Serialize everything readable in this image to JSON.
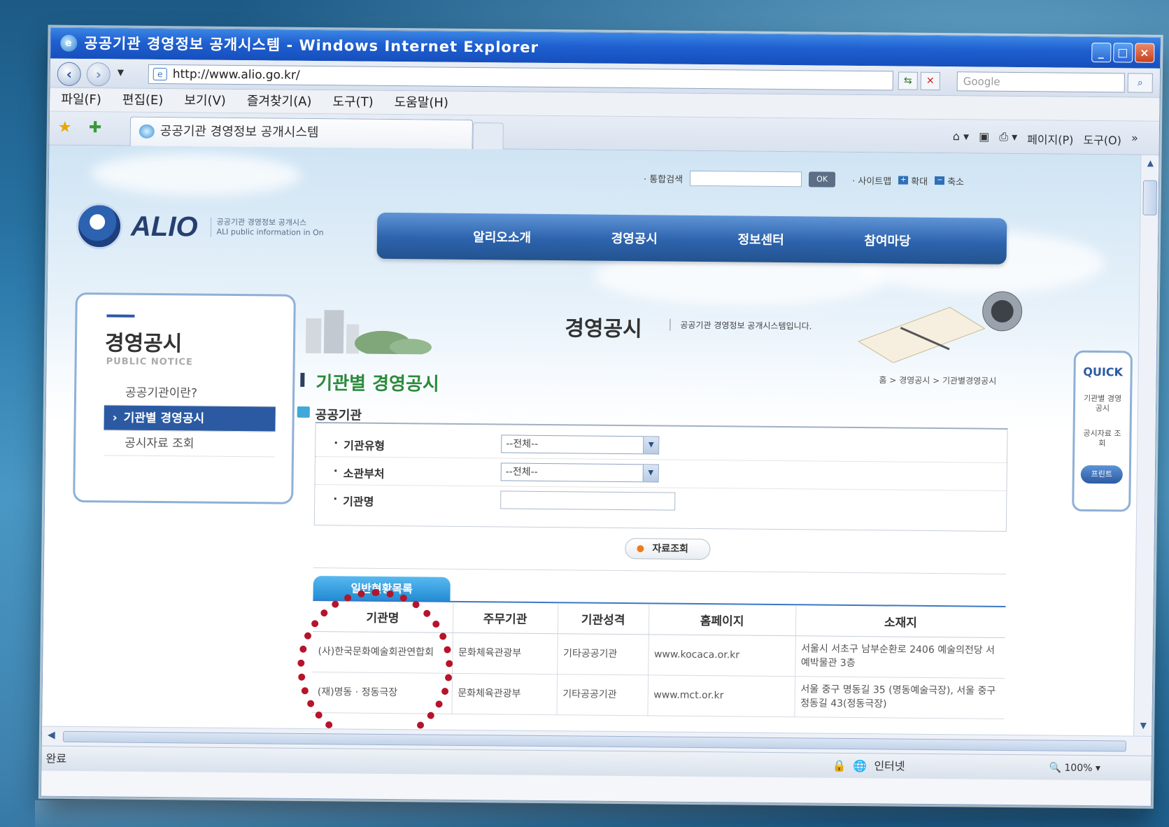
{
  "window": {
    "title": "공공기관 경영정보 공개시스템 - Windows Internet Explorer",
    "address": "http://www.alio.go.kr/",
    "search_placeholder": "Google"
  },
  "menubar": [
    "파일(F)",
    "편집(E)",
    "보기(V)",
    "즐겨찾기(A)",
    "도구(T)",
    "도움말(H)"
  ],
  "tab": {
    "label": "공공기관 경영정보 공개시스템"
  },
  "commandbar": {
    "page": "페이지(P)",
    "tools": "도구(O)"
  },
  "site": {
    "top_search_label": "· 통합검색",
    "ok": "OK",
    "sitemap": "· 사이트맵",
    "zoom_in": "확대",
    "zoom_out": "축소",
    "logo": "ALIO",
    "logo_sub_ko": "공공기관 경영정보 공개시스",
    "logo_sub_en": "ALI public information in On",
    "gnb": [
      "알리오소개",
      "경영공시",
      "정보센터",
      "참여마당"
    ]
  },
  "lnb": {
    "title": "경영공시",
    "subtitle": "PUBLIC NOTICE",
    "items": [
      "공공기관이란?",
      "기관별 경영공시",
      "공시자료 조회"
    ]
  },
  "visual": {
    "title": "경영공시",
    "desc": "공공기관 경영정보 공개시스템입니다."
  },
  "quick": {
    "title": "QUICK",
    "item1": "기관별 경영공시",
    "item2": "공시자료 조회",
    "print": "프린트"
  },
  "main": {
    "title": "기관별 경영공시",
    "breadcrumb": "홈 > 경영공시 > 기관별경영공시",
    "section": "공공기관",
    "fields": {
      "type_label": "기관유형",
      "type_value": "--전체--",
      "dept_label": "소관부처",
      "dept_value": "--전체--",
      "name_label": "기관명"
    },
    "view_button": "자료조회",
    "list_tab": "일반현황목록",
    "table": {
      "headers": [
        "기관명",
        "주무기관",
        "기관성격",
        "홈페이지",
        "소재지"
      ],
      "rows": [
        [
          "(사)한국문화예술회관연합회",
          "문화체육관광부",
          "기타공공기관",
          "www.kocaca.or.kr",
          "서울시 서초구 남부순환로 2406 예술의전당 서예박물관 3층"
        ],
        [
          "(재)명동 · 정동극장",
          "문화체육관광부",
          "기타공공기관",
          "www.mct.or.kr",
          "서울 중구 명동길 35 (명동예술극장), 서울 중구 정동길 43(정동극장)"
        ]
      ]
    }
  },
  "status": {
    "done": "완료",
    "zone": "인터넷",
    "zoom": "100%"
  }
}
